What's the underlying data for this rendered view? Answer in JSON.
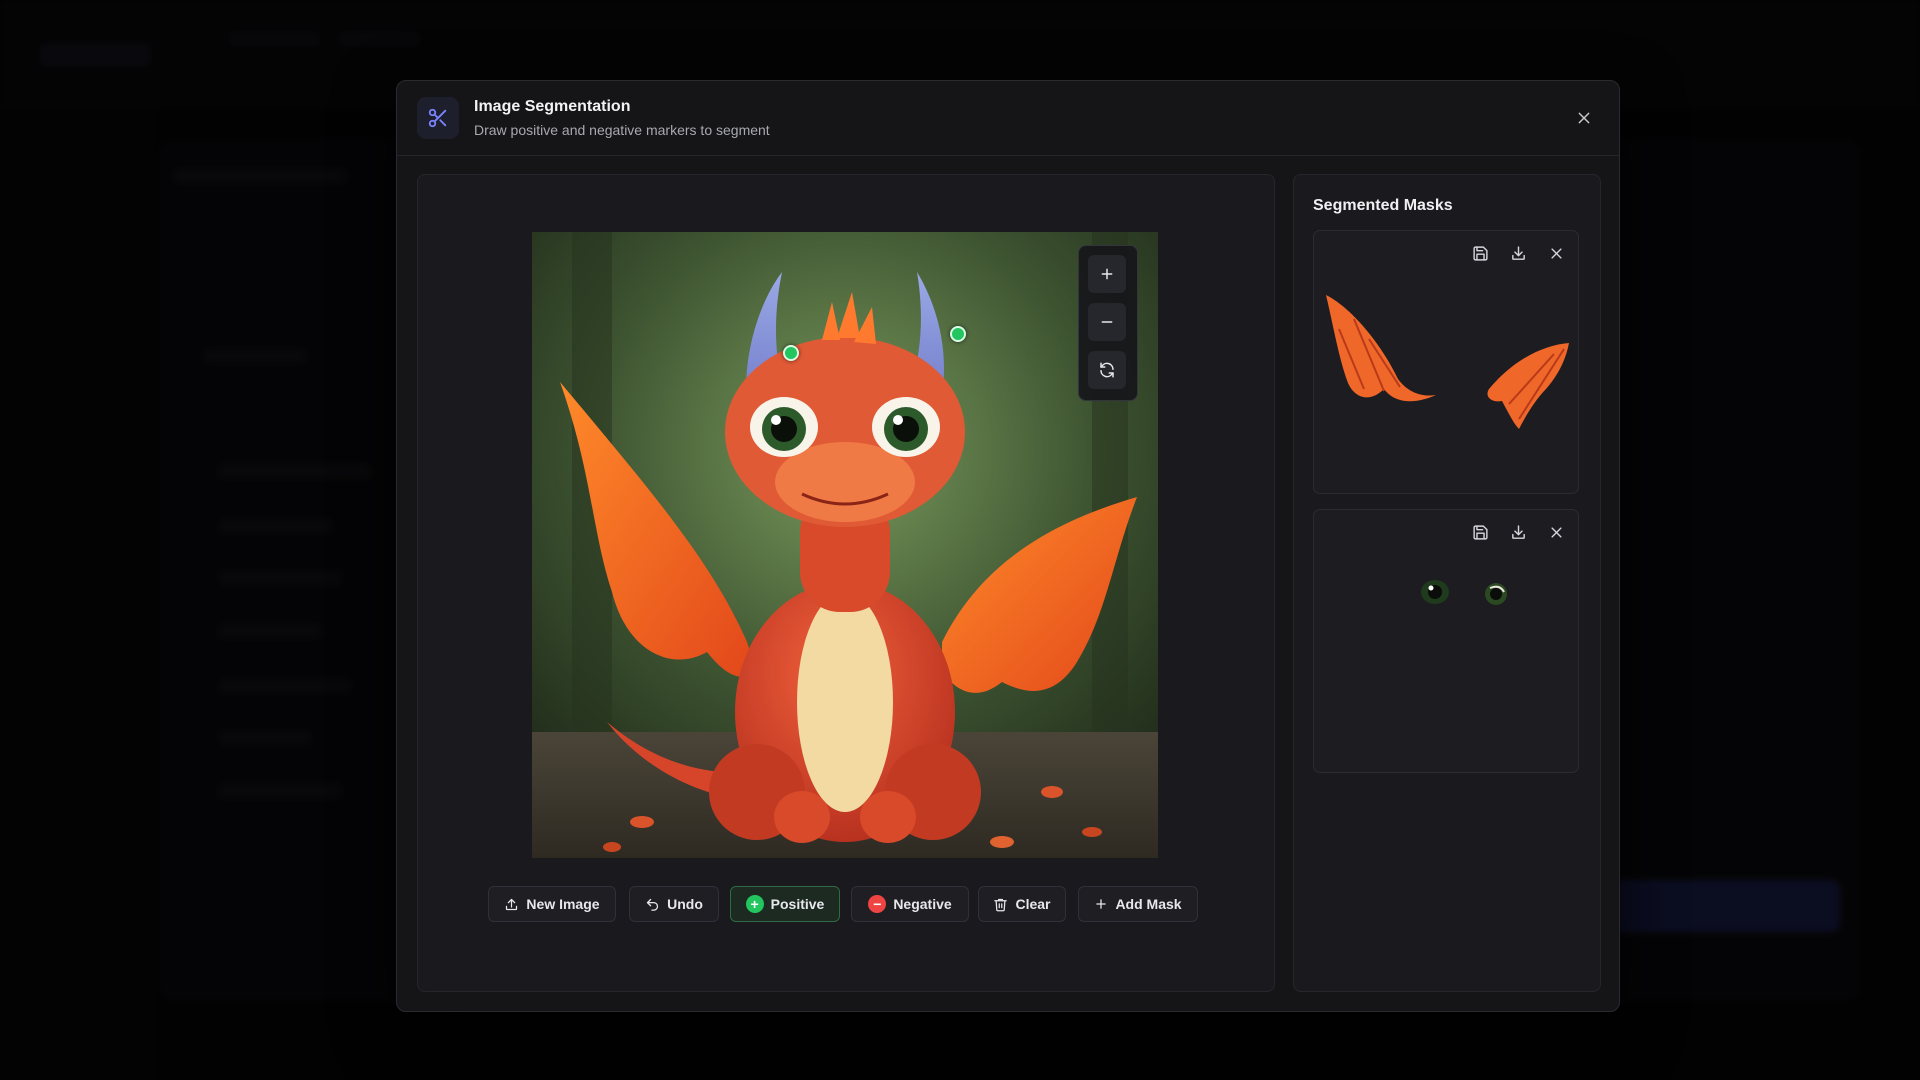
{
  "modal": {
    "title": "Image Segmentation",
    "subtitle": "Draw positive and negative markers to segment"
  },
  "toolbar": {
    "new_image": "New Image",
    "undo": "Undo",
    "positive": "Positive",
    "negative": "Negative",
    "clear": "Clear",
    "add_mask": "Add Mask",
    "active_mode": "Positive"
  },
  "masks": {
    "title": "Segmented Masks",
    "items": [
      {
        "name": "wings",
        "actions": [
          "save-icon",
          "download-icon",
          "close-icon"
        ]
      },
      {
        "name": "eyes",
        "actions": [
          "save-icon",
          "download-icon",
          "close-icon"
        ]
      }
    ]
  },
  "colors": {
    "positive": "#22c55e",
    "negative": "#ef4444",
    "accent": "#6366f1"
  },
  "icons": {
    "header": "scissors-icon",
    "zoom_in": "plus-icon",
    "zoom_out": "minus-icon",
    "reset": "refresh-icon"
  }
}
